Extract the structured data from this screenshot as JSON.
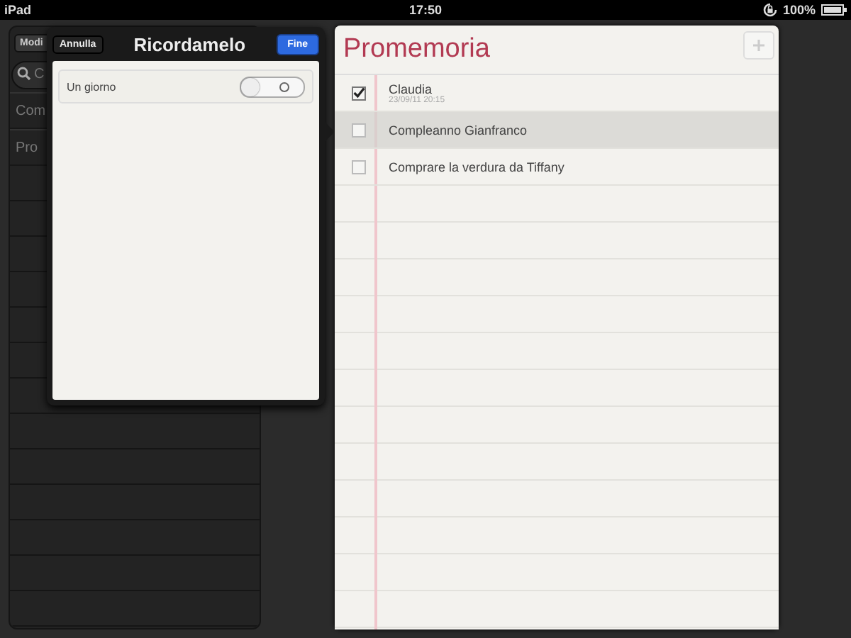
{
  "status_bar": {
    "device": "iPad",
    "time": "17:50",
    "battery": "100%"
  },
  "sidebar": {
    "edit_button": "Modi",
    "search": {
      "placeholder": "C"
    },
    "items": [
      {
        "label": "Com"
      },
      {
        "label": "Pro"
      }
    ]
  },
  "popover": {
    "title": "Ricordamelo",
    "cancel_button": "Annulla",
    "done_button": "Fine",
    "options": [
      {
        "label": "Un giorno",
        "on": false
      }
    ]
  },
  "list": {
    "title": "Promemoria",
    "reminders": [
      {
        "title": "Claudia",
        "date": "23/09/11 20:15",
        "checked": true,
        "selected": false
      },
      {
        "title": "Compleanno Gianfranco",
        "checked": false,
        "selected": true
      },
      {
        "title": "Comprare la verdura da Tiffany",
        "checked": false,
        "selected": false
      }
    ]
  }
}
